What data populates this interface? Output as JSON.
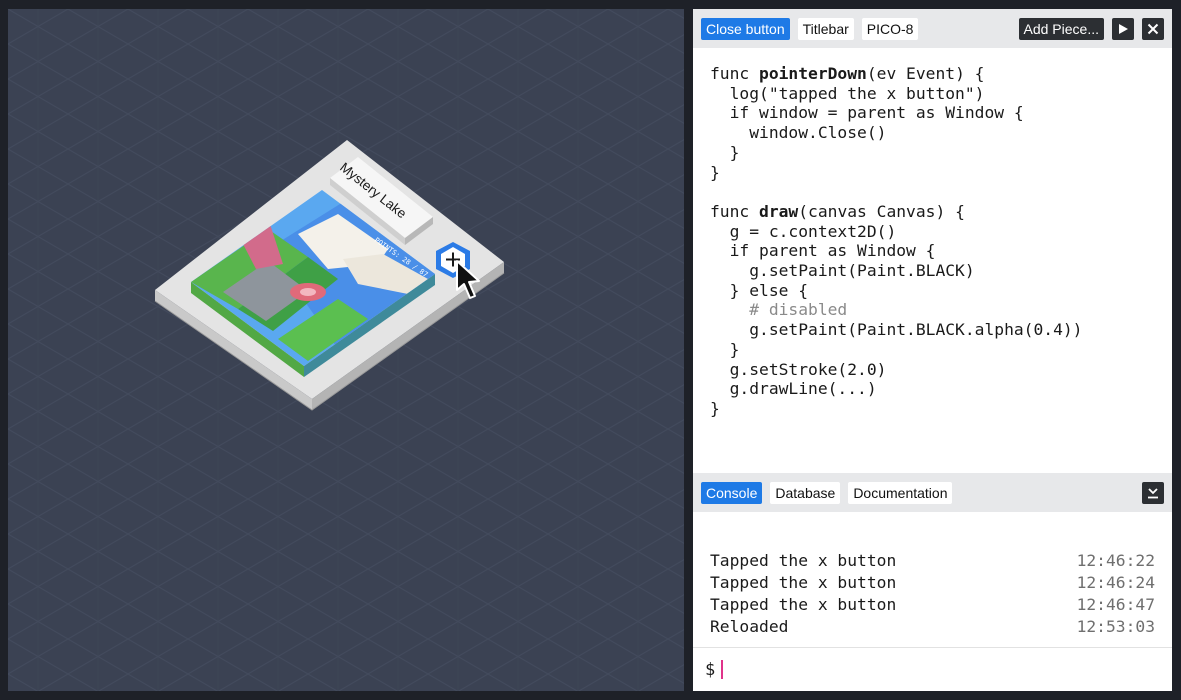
{
  "canvas": {
    "background": "#3b4253",
    "card": {
      "title": "Mystery Lake",
      "points_text": "POINTS: 28 / 87",
      "add_icon": "plus-hexagon-icon",
      "cursor_icon": "mouse-pointer-icon"
    }
  },
  "editor": {
    "tabs": [
      {
        "label": "Close button",
        "active": true
      },
      {
        "label": "Titlebar",
        "active": false
      },
      {
        "label": "PICO-8",
        "active": false
      }
    ],
    "add_piece_label": "Add Piece...",
    "run_icon": "play-icon",
    "close_icon": "close-icon",
    "code_lines": [
      "func pointerDown(ev Event) {",
      "  log(\"tapped the x button\")",
      "  if window = parent as Window {",
      "    window.Close()",
      "  }",
      "}",
      "",
      "func draw(canvas Canvas) {",
      "  g = c.context2D()",
      "  if parent as Window {",
      "    g.setPaint(Paint.BLACK)",
      "  } else {",
      "    # disabled",
      "    g.setPaint(Paint.BLACK.alpha(0.4))",
      "  }",
      "  g.setStroke(2.0)",
      "  g.drawLine(...)",
      "}"
    ]
  },
  "console": {
    "tabs": [
      {
        "label": "Console",
        "active": true
      },
      {
        "label": "Database",
        "active": false
      },
      {
        "label": "Documentation",
        "active": false
      }
    ],
    "collapse_icon": "collapse-down-icon",
    "logs": [
      {
        "message": "Tapped the x button",
        "time": "12:46:22"
      },
      {
        "message": "Tapped the x button",
        "time": "12:46:24"
      },
      {
        "message": "Tapped the x button",
        "time": "12:46:47"
      },
      {
        "message": "Reloaded",
        "time": "12:53:03"
      }
    ],
    "prompt_symbol": "$"
  },
  "colors": {
    "accent": "#1e7ae6",
    "dark_button": "#2c2f33",
    "caret": "#e0338a"
  }
}
